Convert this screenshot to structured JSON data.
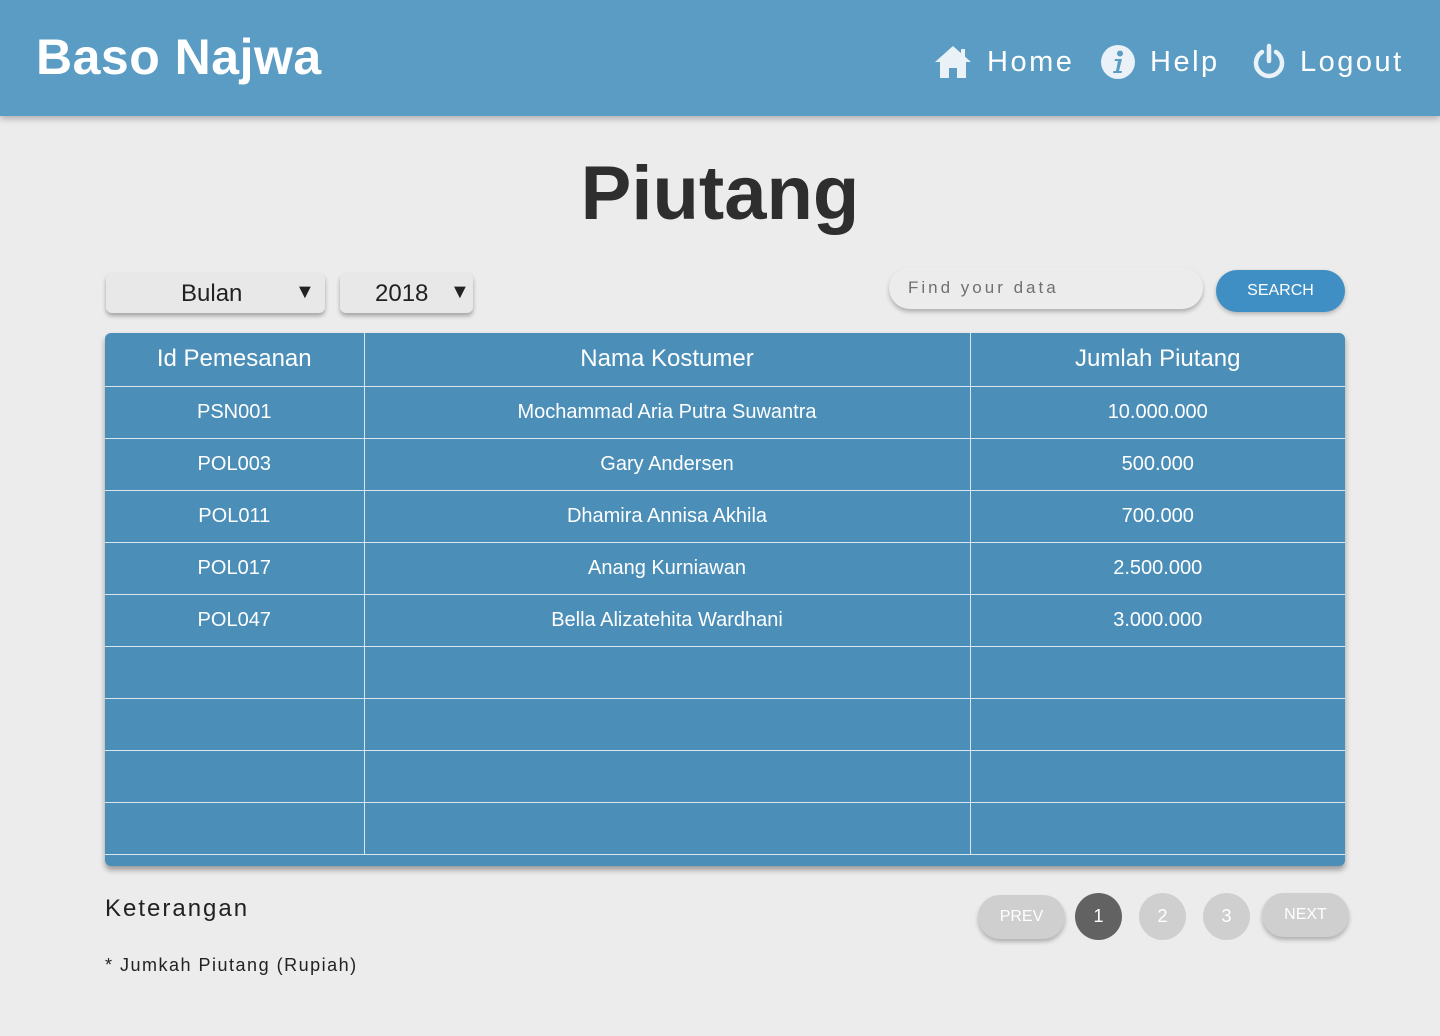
{
  "header": {
    "brand": "Baso Najwa",
    "nav": [
      {
        "label": "Home",
        "icon": "home-icon"
      },
      {
        "label": "Help",
        "icon": "info-icon"
      },
      {
        "label": "Logout",
        "icon": "power-icon"
      }
    ]
  },
  "page": {
    "title": "Piutang"
  },
  "filters": {
    "month": "Bulan",
    "year": "2018",
    "arrow": "▼"
  },
  "search": {
    "placeholder": "Find your data",
    "button": "SEARCH"
  },
  "table": {
    "columns": [
      "Id Pemesanan",
      "Nama Kostumer",
      "Jumlah Piutang"
    ],
    "rows": [
      [
        "PSN001",
        "Mochammad Aria Putra Suwantra",
        "10.000.000"
      ],
      [
        "POL003",
        "Gary Andersen",
        "500.000"
      ],
      [
        "POL011",
        "Dhamira Annisa Akhila",
        "700.000"
      ],
      [
        "POL017",
        "Anang Kurniawan",
        "2.500.000"
      ],
      [
        "POL047",
        "Bella Alizatehita Wardhani",
        "3.000.000"
      ],
      [
        "",
        "",
        ""
      ],
      [
        "",
        "",
        ""
      ],
      [
        "",
        "",
        ""
      ],
      [
        "",
        "",
        ""
      ]
    ]
  },
  "legend": {
    "title": "Keterangan",
    "note": "* Jumkah Piutang (Rupiah)"
  },
  "pagination": {
    "prev": "PREV",
    "pages": [
      "1",
      "2",
      "3"
    ],
    "current": "1",
    "next": "NEXT"
  },
  "colors": {
    "header": "#5a9cc4",
    "table": "#4b8eb8",
    "search_button": "#3f8fc4",
    "page_active": "#626262",
    "page_inactive": "#cfcfcf"
  }
}
